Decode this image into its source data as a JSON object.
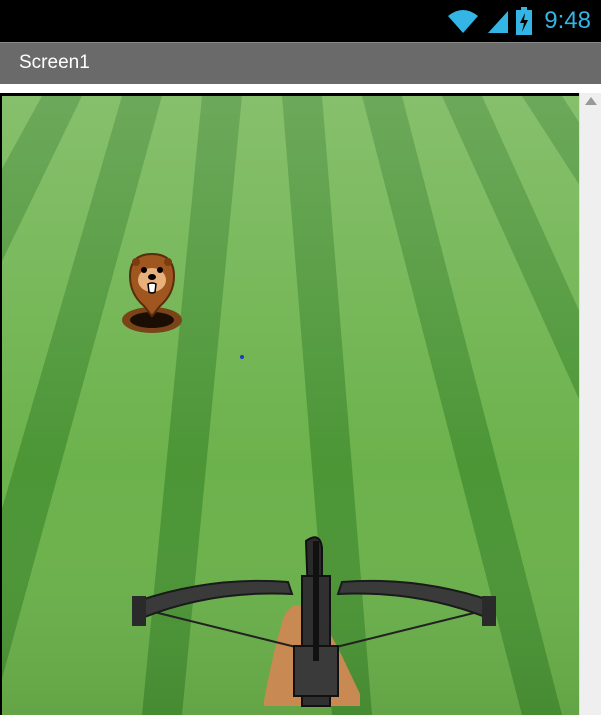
{
  "status_bar": {
    "time": "9:48",
    "icons": [
      "wifi-icon",
      "signal-icon",
      "battery-charging-icon"
    ],
    "accent_color": "#33b5e5"
  },
  "title_bar": {
    "title": "Screen1",
    "background_color": "#6a6a6a"
  },
  "game": {
    "background": "striped-lawn",
    "sprites": [
      "mole-sprite",
      "crossbow-sprite",
      "target-dot"
    ],
    "colors": {
      "grass_dark": "#3f8a2c",
      "grass_light": "#6cb24c",
      "mole_brown": "#a0561f",
      "crossbow": "#3a3a3a"
    }
  }
}
